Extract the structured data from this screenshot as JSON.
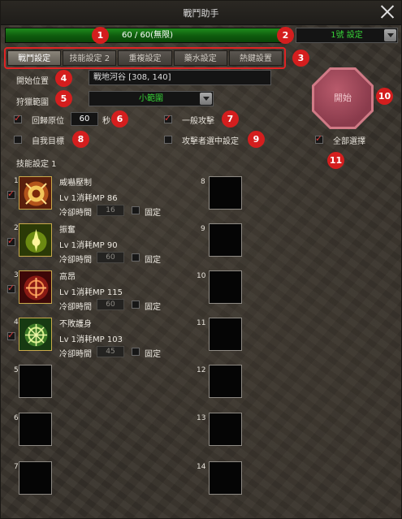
{
  "window": {
    "title": "戰鬥助手"
  },
  "hp_bar": {
    "text": "60 / 60(無限)"
  },
  "setting_select": {
    "value": "1號 設定"
  },
  "tabs": [
    {
      "label": "戰鬥設定",
      "active": true
    },
    {
      "label": "技能設定 2",
      "active": false
    },
    {
      "label": "重複設定",
      "active": false
    },
    {
      "label": "藥水設定",
      "active": false
    },
    {
      "label": "熱鍵設置",
      "active": false
    }
  ],
  "start_position": {
    "label": "開始位置",
    "value": "戰地河谷 [308, 140]"
  },
  "hunt_range": {
    "label": "狩獵範圍",
    "value": "小範圍"
  },
  "options": {
    "return_origin": {
      "label": "回歸原位",
      "checked": true,
      "seconds": "60",
      "unit": "秒"
    },
    "normal_attack": {
      "label": "一般攻擊",
      "checked": true
    },
    "self_target": {
      "label": "自我目標",
      "checked": false
    },
    "attacker_selected": {
      "label": "攻擊者選中設定",
      "checked": false
    },
    "select_all": {
      "label": "全部選擇",
      "checked": true
    }
  },
  "start_button": {
    "label": "開始"
  },
  "markers": [
    "1",
    "2",
    "3",
    "4",
    "5",
    "6",
    "7",
    "8",
    "9",
    "10",
    "11"
  ],
  "skills_title": "技能設定 1",
  "skills": [
    {
      "num": "1",
      "name": "威嚇壓制",
      "level": "Lv 1消耗MP 86",
      "cooldown_label": "冷卻時間",
      "cooldown": "16",
      "fixed_label": "固定",
      "checked": true,
      "fixed": false
    },
    {
      "num": "2",
      "name": "振奮",
      "level": "Lv 1消耗MP 90",
      "cooldown_label": "冷卻時間",
      "cooldown": "60",
      "fixed_label": "固定",
      "checked": true,
      "fixed": false
    },
    {
      "num": "3",
      "name": "高昂",
      "level": "Lv 1消耗MP 115",
      "cooldown_label": "冷卻時間",
      "cooldown": "60",
      "fixed_label": "固定",
      "checked": true,
      "fixed": false
    },
    {
      "num": "4",
      "name": "不敗護身",
      "level": "Lv 1消耗MP 103",
      "cooldown_label": "冷卻時間",
      "cooldown": "45",
      "fixed_label": "固定",
      "checked": true,
      "fixed": false
    }
  ],
  "empty_slots": [
    "5",
    "6",
    "7",
    "8",
    "9",
    "10",
    "11",
    "12",
    "13",
    "14"
  ],
  "colors": {
    "accent_red": "#d41e1e",
    "hp_green": "#1f8a1c",
    "value_green": "#37d437"
  }
}
